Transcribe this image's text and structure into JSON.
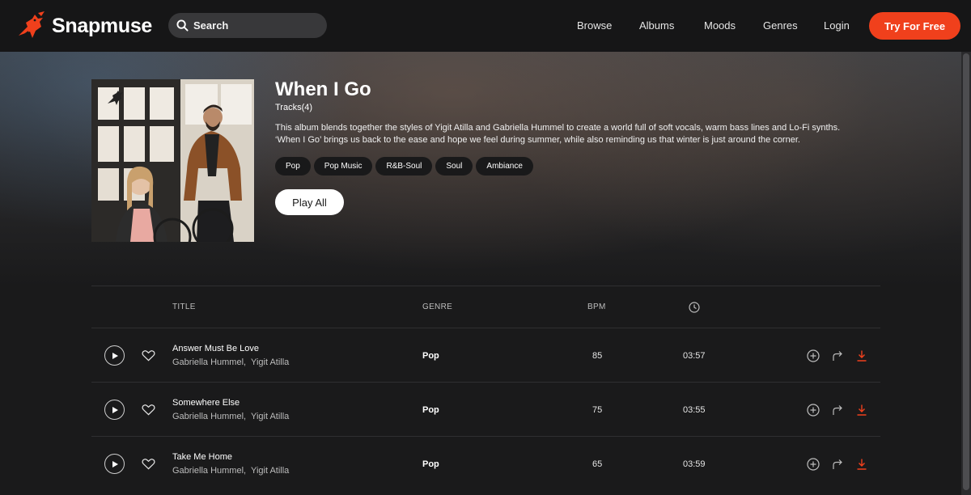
{
  "brand": {
    "name": "Snapmuse",
    "accent": "#f0401c"
  },
  "search": {
    "placeholder": "Search"
  },
  "nav": {
    "items": [
      {
        "label": "Browse"
      },
      {
        "label": "Albums"
      },
      {
        "label": "Moods"
      },
      {
        "label": "Genres"
      },
      {
        "label": "Login"
      }
    ],
    "cta": "Try For Free"
  },
  "album": {
    "title": "When I Go",
    "tracks_label": "Tracks(4)",
    "description_1": "This album blends together the styles of Yigit Atilla and Gabriella Hummel to create a world full of soft vocals, warm bass lines and Lo-Fi synths.",
    "description_2": "‘When I Go’ brings us back to the ease and hope we feel during summer, while also reminding us that winter is just around the corner.",
    "tags": [
      "Pop",
      "Pop Music",
      "R&B-Soul",
      "Soul",
      "Ambiance"
    ],
    "play_all": "Play All"
  },
  "table": {
    "headers": {
      "title": "TITLE",
      "genre": "GENRE",
      "bpm": "BPM",
      "duration_icon": "clock-icon"
    },
    "tracks": [
      {
        "title": "Answer Must Be Love",
        "artist_1": "Gabriella Hummel",
        "artist_2": "Yigit Atilla",
        "genre": "Pop",
        "bpm": "85",
        "duration": "03:57"
      },
      {
        "title": "Somewhere Else",
        "artist_1": "Gabriella Hummel",
        "artist_2": "Yigit Atilla",
        "genre": "Pop",
        "bpm": "75",
        "duration": "03:55"
      },
      {
        "title": "Take Me Home",
        "artist_1": "Gabriella Hummel",
        "artist_2": "Yigit Atilla",
        "genre": "Pop",
        "bpm": "65",
        "duration": "03:59"
      }
    ],
    "row_actions": [
      "play-icon",
      "heart-icon",
      "add-icon",
      "share-icon",
      "download-icon"
    ]
  }
}
